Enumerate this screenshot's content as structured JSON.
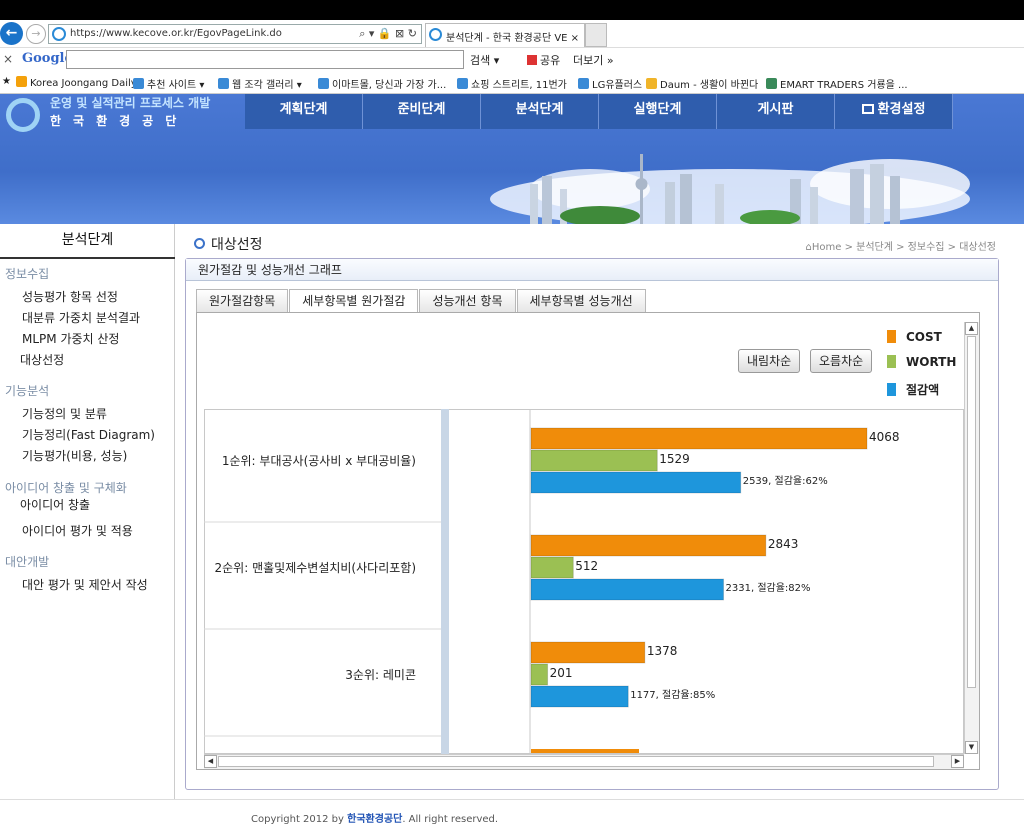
{
  "browser": {
    "url": "https://www.kecove.or.kr/EgovPageLink.do",
    "address_tools": "⌕ ▾ 🔒 ⊠ ↻",
    "tab_title": "분석단계 - 한국 환경공단 VE ×",
    "google_logo": "Google",
    "search_btn": "검색 ▾",
    "share_btn": "공유",
    "more_btn": "더보기 »",
    "favorites": [
      {
        "label": "Korea Joongang Daily",
        "color": "#f4a10b"
      },
      {
        "label": "추천 사이트 ▾",
        "color": "#3a8ad6"
      },
      {
        "label": "웹 조각 갤러리 ▾",
        "color": "#3a8ad6"
      },
      {
        "label": "이마트몰, 당신과 가장 가...",
        "color": "#3a8ad6"
      },
      {
        "label": "쇼핑 스트리트, 11번가",
        "color": "#3a8ad6"
      },
      {
        "label": "LG유플러스",
        "color": "#3a8ad6"
      },
      {
        "label": "Daum - 생활이 바뀐다",
        "color": "#f0b429"
      },
      {
        "label": "EMART TRADERS 거룡을 ...",
        "color": "#3a8a5a"
      }
    ]
  },
  "site": {
    "logo_line1": "운영 및 실적관리 프로세스 개발",
    "logo_line2": "한국환경공단",
    "nav": [
      "계획단계",
      "준비단계",
      "분석단계",
      "실행단계",
      "게시판",
      "환경설정"
    ]
  },
  "sidebar": {
    "title": "분석단계",
    "sections": [
      {
        "label": "정보수집",
        "items": [
          "성능평가 항목 선정",
          "대분류 가중치 분석결과",
          "MLPM 가중치 산정",
          "대상선정"
        ]
      },
      {
        "label": "기능분석",
        "items": [
          "기능정의 및 분류",
          "기능정리(Fast Diagram)",
          "기능평가(비용, 성능)"
        ]
      },
      {
        "label": "아이디어 창출 및 구체화",
        "items": [
          "아이디어 창출",
          "아이디어 평가 및 적용"
        ]
      },
      {
        "label": "대안개발",
        "items": [
          "대안 평가 및 제안서 작성"
        ]
      }
    ]
  },
  "main": {
    "page_title": "대상선정",
    "breadcrumb": "Home > 분석단계 > 정보수집 > 대상선정",
    "panel_title": "원가절감 및 성능개선 그래프",
    "tabs": [
      "원가절감항목",
      "세부항목별 원가절감",
      "성능개선 항목",
      "세부항목별 성능개선"
    ],
    "sort_desc": "내림차순",
    "sort_asc": "오름차순"
  },
  "chart_data": {
    "type": "bar",
    "orientation": "horizontal",
    "categories": [
      "1순위: 부대공사(공사비 x 부대공비율)",
      "2순위: 맨홀및제수변설치비(사다리포함)",
      "3순위: 레미콘"
    ],
    "series": [
      {
        "name": "COST",
        "color": "#f08c0a",
        "values": [
          4068,
          2843,
          1378
        ]
      },
      {
        "name": "WORTH",
        "color": "#9bc053",
        "values": [
          1529,
          512,
          201
        ]
      },
      {
        "name": "절감액",
        "color": "#1e96dc",
        "values": [
          2539,
          2331,
          1177
        ]
      }
    ],
    "data_labels": [
      [
        "4068",
        "1529",
        "2539, 절감율:62%"
      ],
      [
        "2843",
        "512",
        "2331, 절감율:82%"
      ],
      [
        "1378",
        "201",
        "1177, 절감율:85%"
      ]
    ],
    "legend_position": "top-right",
    "xlim": [
      0,
      4068
    ]
  },
  "footer": {
    "prefix": "Copyright 2012 by ",
    "org": "한국환경공단",
    "suffix": ". All right reserved."
  }
}
